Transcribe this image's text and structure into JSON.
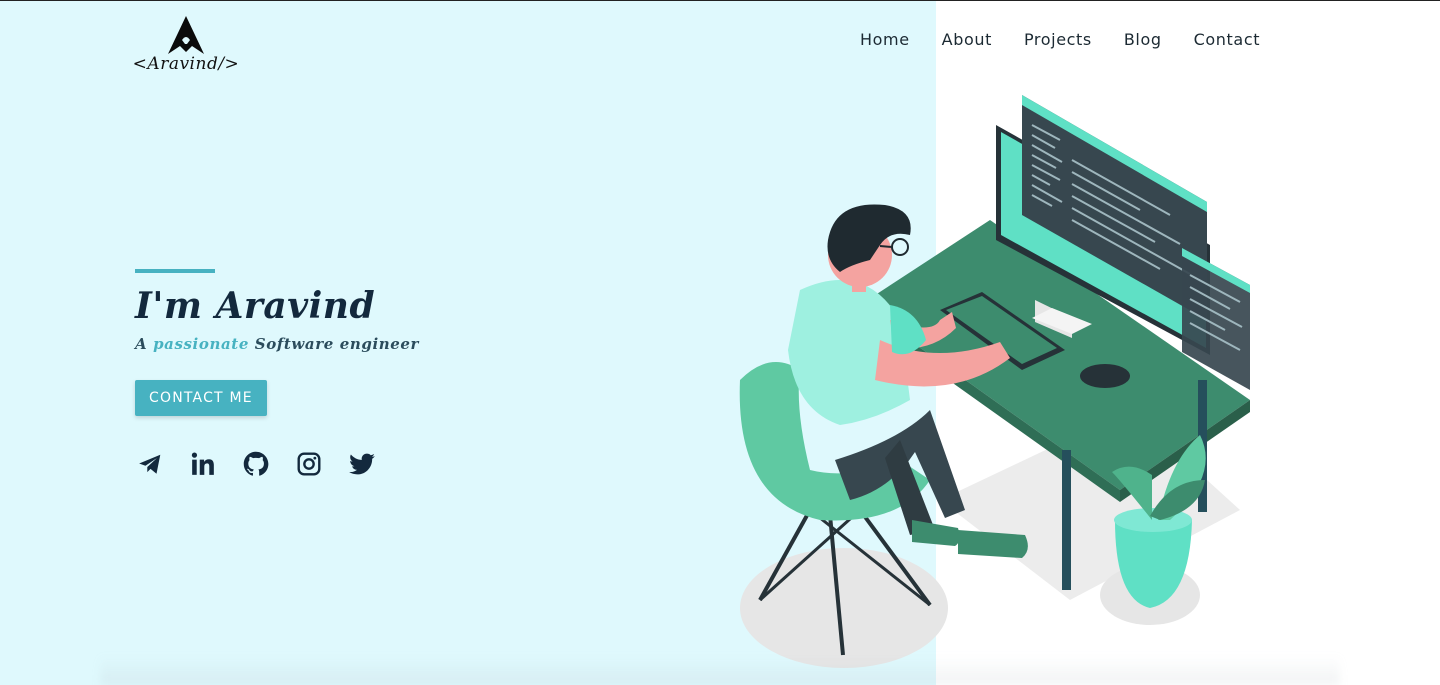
{
  "brand": {
    "logo_text": "<Aravind/>"
  },
  "nav": {
    "items": [
      {
        "label": "Home"
      },
      {
        "label": "About"
      },
      {
        "label": "Projects"
      },
      {
        "label": "Blog"
      },
      {
        "label": "Contact"
      }
    ]
  },
  "hero": {
    "title": "I'm Aravind",
    "subtitle_prefix": "A ",
    "subtitle_highlight": "passionate",
    "subtitle_suffix": " Software engineer",
    "cta_label": "CONTACT ME"
  },
  "socials": [
    {
      "icon": "telegram-icon"
    },
    {
      "icon": "linkedin-icon"
    },
    {
      "icon": "github-icon"
    },
    {
      "icon": "instagram-icon"
    },
    {
      "icon": "twitter-icon"
    }
  ],
  "colors": {
    "panel_bg": "#dff9fd",
    "accent": "#47b2c1",
    "heading": "#13293d",
    "illustration_green": "#3d8c6e",
    "illustration_mint": "#5fe0c5"
  }
}
